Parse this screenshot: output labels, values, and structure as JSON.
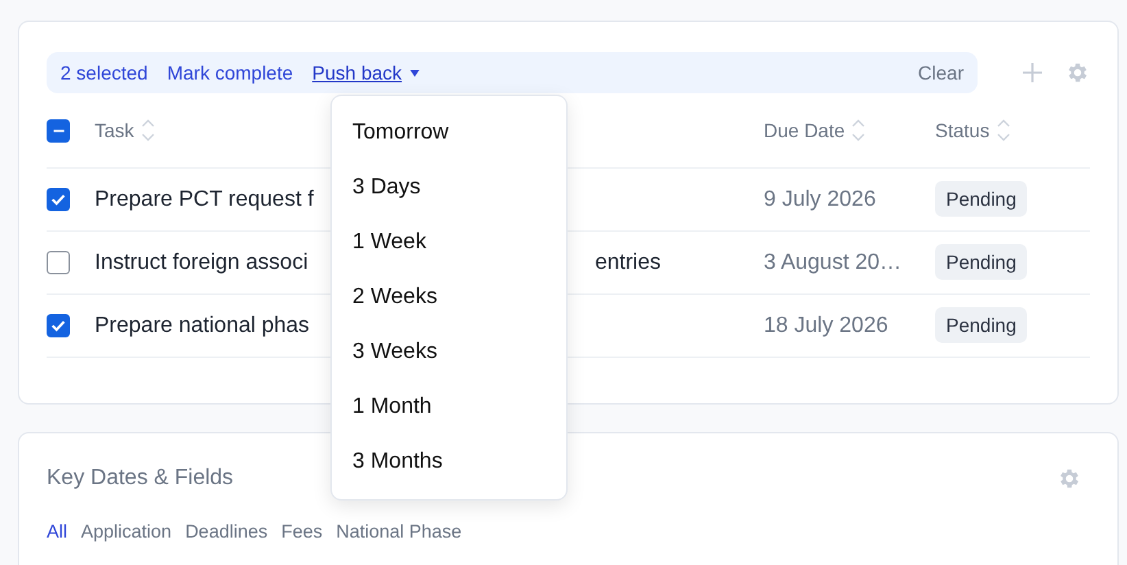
{
  "bulk_bar": {
    "selected_count": "2 selected",
    "actions": [
      {
        "label": "Mark complete",
        "kind": "link"
      },
      {
        "label": "Push back",
        "kind": "dropdown",
        "expanded": true
      }
    ],
    "clear": "Clear"
  },
  "table": {
    "select_all": {
      "indeterminate": true
    },
    "columns": [
      "Task",
      "Due Date",
      "Status"
    ],
    "rows": [
      {
        "checked": true,
        "task": "Prepare PCT request f",
        "due": "9 July 2026",
        "status": "Pending"
      },
      {
        "checked": false,
        "task": "Instruct foreign associ",
        "task_tail": "entries",
        "due": "3 August 20…",
        "status": "Pending"
      },
      {
        "checked": true,
        "task": "Prepare national phas",
        "due": "18 July 2026",
        "status": "Pending"
      }
    ]
  },
  "push_back_menu": [
    "Tomorrow",
    "3 Days",
    "1 Week",
    "2 Weeks",
    "3 Weeks",
    "1 Month",
    "3 Months"
  ],
  "key_dates": {
    "title": "Key Dates & Fields",
    "filters": [
      {
        "label": "All",
        "selected": true
      },
      {
        "label": "Application",
        "selected": false
      },
      {
        "label": "Deadlines",
        "selected": false
      },
      {
        "label": "Fees",
        "selected": false
      },
      {
        "label": "National Phase",
        "selected": false
      }
    ]
  }
}
